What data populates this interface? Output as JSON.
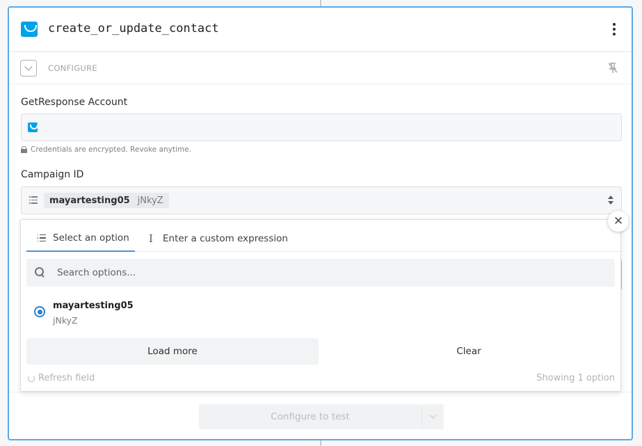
{
  "step": {
    "title": "create_or_update_contact",
    "app_logo": "getresponse-logo",
    "menu_icon": "more-vertical-icon"
  },
  "section": {
    "label": "CONFIGURE",
    "pin_icon": "unpin-icon"
  },
  "fields": {
    "account": {
      "label": "GetResponse Account",
      "value": "",
      "note": "Credentials are encrypted. Revoke anytime."
    },
    "campaign": {
      "label": "Campaign ID",
      "selected_label": "mayartesting05",
      "selected_id": "jNkyZ"
    }
  },
  "dropdown": {
    "tabs": [
      {
        "label": "Select an option",
        "active": true
      },
      {
        "label": "Enter a custom expression",
        "active": false
      }
    ],
    "search_placeholder": "Search options...",
    "options": [
      {
        "label": "mayartesting05",
        "sub": "jNkyZ",
        "selected": true
      }
    ],
    "load_more": "Load more",
    "clear": "Clear",
    "refresh": "Refresh field",
    "showing": "Showing 1 option",
    "close_icon": "close-icon"
  },
  "footer": {
    "configure_button": "Configure to test"
  },
  "colors": {
    "accent": "#5aa9e6",
    "brand": "#00a2e8",
    "radio": "#2b7fc8"
  }
}
